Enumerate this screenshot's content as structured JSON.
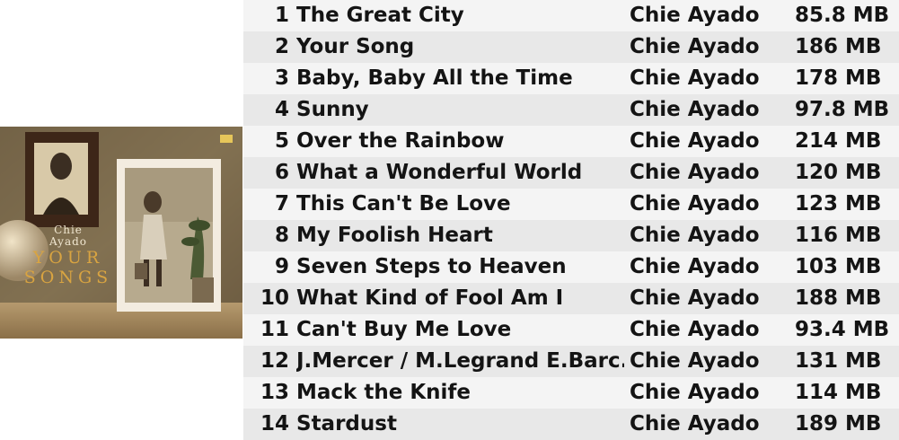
{
  "album": {
    "cover_artist": "Chie\nAyado",
    "cover_artist_line1": "Chie",
    "cover_artist_line2": "Ayado",
    "cover_title_line1": "YOUR",
    "cover_title_line2": "SONGS"
  },
  "tracks": [
    {
      "num": "1",
      "title": "The Great City",
      "artist": "Chie Ayado",
      "size": "85.8 MB"
    },
    {
      "num": "2",
      "title": "Your Song",
      "artist": "Chie Ayado",
      "size": "186 MB"
    },
    {
      "num": "3",
      "title": "Baby, Baby All the Time",
      "artist": "Chie Ayado",
      "size": "178 MB"
    },
    {
      "num": "4",
      "title": "Sunny",
      "artist": "Chie Ayado",
      "size": "97.8 MB"
    },
    {
      "num": "5",
      "title": "Over the Rainbow",
      "artist": "Chie Ayado",
      "size": "214 MB"
    },
    {
      "num": "6",
      "title": "What a Wonderful World",
      "artist": "Chie Ayado",
      "size": "120 MB"
    },
    {
      "num": "7",
      "title": "This Can't Be Love",
      "artist": "Chie Ayado",
      "size": "123 MB"
    },
    {
      "num": "8",
      "title": "My Foolish Heart",
      "artist": "Chie Ayado",
      "size": "116 MB"
    },
    {
      "num": "9",
      "title": "Seven Steps to Heaven",
      "artist": "Chie Ayado",
      "size": "103 MB"
    },
    {
      "num": "10",
      "title": "What Kind of Fool Am I",
      "artist": "Chie Ayado",
      "size": "188 MB"
    },
    {
      "num": "11",
      "title": "Can't Buy Me Love",
      "artist": "Chie Ayado",
      "size": "93.4 MB"
    },
    {
      "num": "12",
      "title": "J.Mercer / M.Legrand E.Barc...",
      "artist": "Chie Ayado",
      "size": "131 MB"
    },
    {
      "num": "13",
      "title": "Mack the Knife",
      "artist": "Chie Ayado",
      "size": "114 MB"
    },
    {
      "num": "14",
      "title": "Stardust",
      "artist": "Chie Ayado",
      "size": "189 MB"
    }
  ],
  "colors": {
    "row_odd": "#f4f4f4",
    "row_even": "#e8e8e8",
    "text": "#141414",
    "cover_gold": "#d9a441"
  }
}
